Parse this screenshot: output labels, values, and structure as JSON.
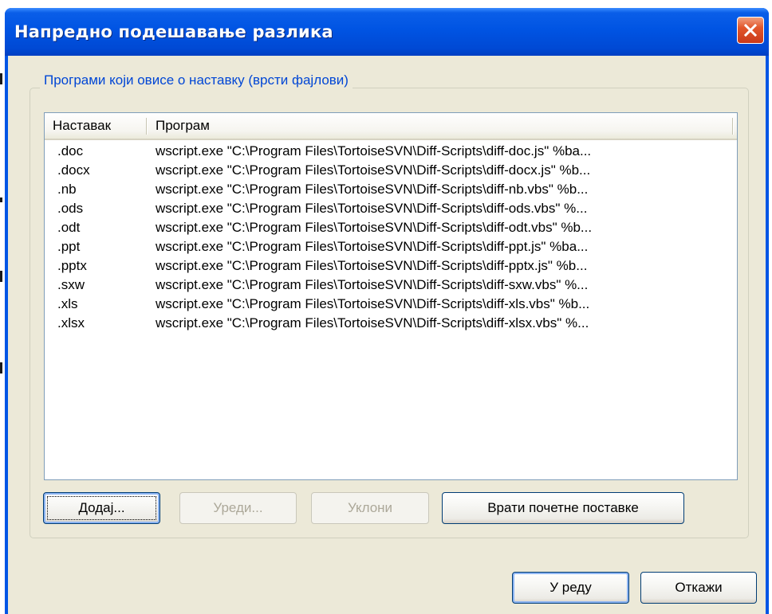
{
  "window": {
    "title": "Напредно подешавање разлика",
    "close_icon": "close-icon"
  },
  "group": {
    "label": "Програми који овисе о наставку (врсти фајлови)"
  },
  "list": {
    "columns": [
      "Наставак",
      "Програм"
    ],
    "rows": [
      {
        "ext": ".doc",
        "program": "wscript.exe \"C:\\Program Files\\TortoiseSVN\\Diff-Scripts\\diff-doc.js\" %ba..."
      },
      {
        "ext": ".docx",
        "program": "wscript.exe \"C:\\Program Files\\TortoiseSVN\\Diff-Scripts\\diff-docx.js\" %b..."
      },
      {
        "ext": ".nb",
        "program": "wscript.exe \"C:\\Program Files\\TortoiseSVN\\Diff-Scripts\\diff-nb.vbs\" %b..."
      },
      {
        "ext": ".ods",
        "program": "wscript.exe \"C:\\Program Files\\TortoiseSVN\\Diff-Scripts\\diff-ods.vbs\" %..."
      },
      {
        "ext": ".odt",
        "program": "wscript.exe \"C:\\Program Files\\TortoiseSVN\\Diff-Scripts\\diff-odt.vbs\" %b..."
      },
      {
        "ext": ".ppt",
        "program": "wscript.exe \"C:\\Program Files\\TortoiseSVN\\Diff-Scripts\\diff-ppt.js\" %ba..."
      },
      {
        "ext": ".pptx",
        "program": "wscript.exe \"C:\\Program Files\\TortoiseSVN\\Diff-Scripts\\diff-pptx.js\" %b..."
      },
      {
        "ext": ".sxw",
        "program": "wscript.exe \"C:\\Program Files\\TortoiseSVN\\Diff-Scripts\\diff-sxw.vbs\" %..."
      },
      {
        "ext": ".xls",
        "program": "wscript.exe \"C:\\Program Files\\TortoiseSVN\\Diff-Scripts\\diff-xls.vbs\" %b..."
      },
      {
        "ext": ".xlsx",
        "program": "wscript.exe \"C:\\Program Files\\TortoiseSVN\\Diff-Scripts\\diff-xlsx.vbs\" %..."
      }
    ]
  },
  "buttons": {
    "add": "Додај...",
    "edit": "Уреди...",
    "remove": "Уклони",
    "restore_defaults": "Врати почетне поставке",
    "ok": "У реду",
    "cancel": "Откажи"
  },
  "colors": {
    "titlebar": "#0054e3",
    "client_bg": "#ece9d8",
    "group_label": "#0046d5",
    "close_button": "#e2572b",
    "disabled_text": "#aca899"
  }
}
